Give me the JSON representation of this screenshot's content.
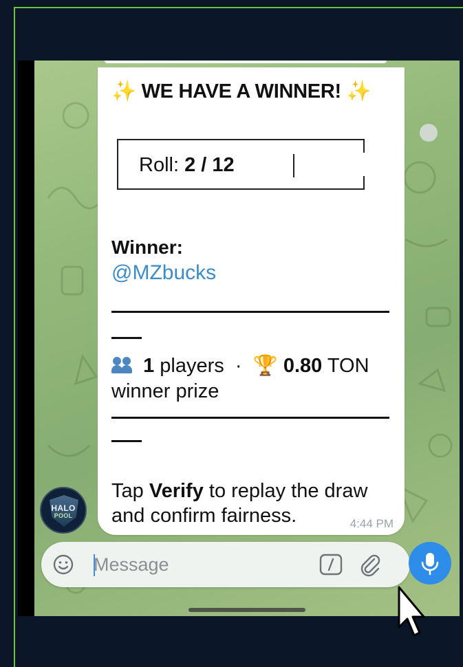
{
  "message": {
    "title": "WE HAVE A WINNER!",
    "sparkle": "✨",
    "roll_label": "Roll:",
    "roll_value": "2 / 12",
    "winner_label": "Winner:",
    "winner_handle": "@MZbucks",
    "players_count": "1",
    "players_label": "players",
    "separator": "·",
    "trophy": "🏆",
    "prize_amount": "0.80",
    "prize_currency": "TON",
    "prize_label": "winner prize",
    "verify_prefix": "Tap",
    "verify_word": "Verify",
    "verify_suffix": "to replay the draw",
    "verify_line2": "and confirm fairness.",
    "time": "4:44 PM"
  },
  "avatar": {
    "line1": "HALO",
    "line2": "POOL"
  },
  "composer": {
    "placeholder": "Message"
  },
  "colors": {
    "link": "#3a8dc9",
    "mic_button": "#2e8de8",
    "frame_border": "#6fc33a",
    "background": "#0b1629"
  },
  "icons": [
    "emoji-icon",
    "bot-command-icon",
    "paperclip-icon",
    "microphone-icon",
    "people-icon",
    "trophy-icon",
    "sparkle-icon",
    "mouse-cursor-icon"
  ]
}
